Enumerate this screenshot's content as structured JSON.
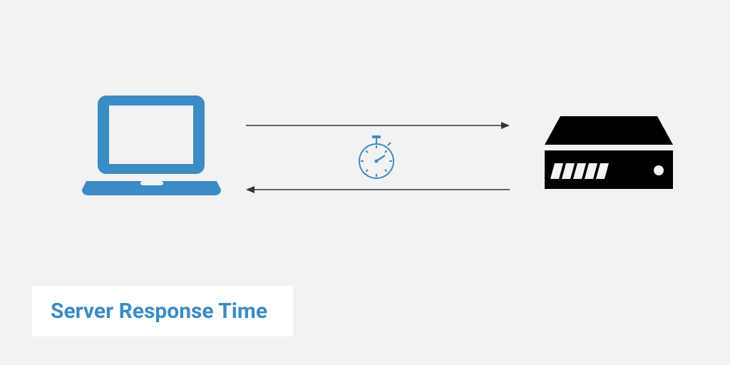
{
  "title": "Server Response Time",
  "colors": {
    "accent": "#3b8bc4",
    "fg": "#000000",
    "bg": "#f2f2f2",
    "panel": "#ffffff",
    "arrow": "#333333"
  },
  "icons": {
    "laptop": "laptop-icon",
    "server": "server-icon",
    "stopwatch": "stopwatch-icon"
  }
}
